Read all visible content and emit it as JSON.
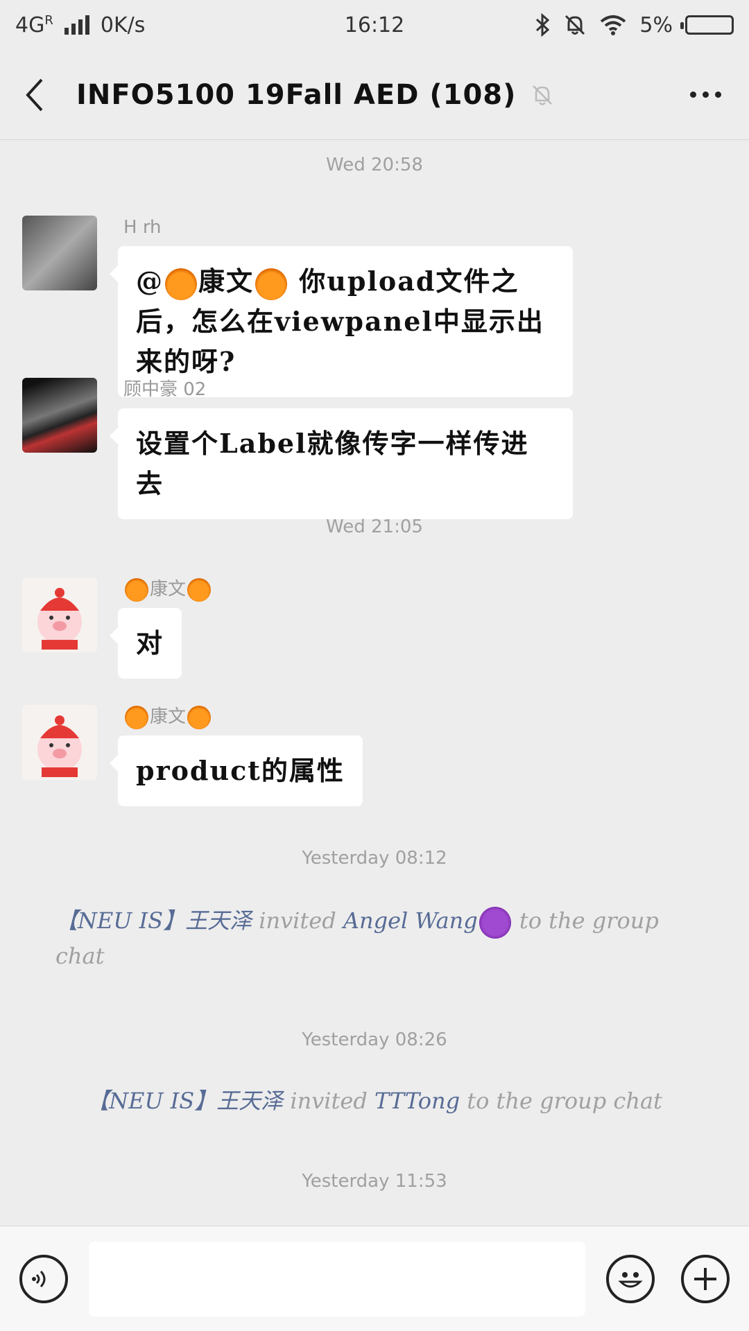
{
  "status_bar": {
    "network": "4G",
    "network_sup": "R",
    "speed": "0K/s",
    "time": "16:12",
    "battery": "5%"
  },
  "header": {
    "title": "INFO5100 19Fall AED (108)"
  },
  "messages": [
    {
      "type": "timestamp",
      "text": "Wed 20:58"
    },
    {
      "type": "message",
      "sender": "H rh",
      "text_prefix": "@",
      "mention_name": "康文",
      "text": " 你upload文件之后，怎么在viewpanel中显示出来的呀?"
    },
    {
      "type": "message",
      "sender": "顾中豪 02",
      "text": "设置个Label就像传字一样传进去"
    },
    {
      "type": "timestamp",
      "text": "Wed 21:05"
    },
    {
      "type": "message",
      "sender": "康文",
      "text": "对"
    },
    {
      "type": "message",
      "sender": "康文",
      "text": "product的属性"
    },
    {
      "type": "timestamp",
      "text": "Yesterday 08:12"
    },
    {
      "type": "system",
      "actor": "【NEU IS】王天泽",
      "verb": " invited ",
      "target": "Angel Wang",
      "suffix": " to the group chat"
    },
    {
      "type": "timestamp",
      "text": "Yesterday 08:26"
    },
    {
      "type": "system",
      "actor": "【NEU IS】王天泽",
      "verb": " invited ",
      "target": "TTTong",
      "suffix": " to the group chat"
    },
    {
      "type": "timestamp",
      "text": "Yesterday 11:53"
    }
  ],
  "input": {
    "placeholder": ""
  },
  "icons": {
    "back": "back-arrow-icon",
    "mute": "bell-off-icon",
    "more": "more-icon",
    "voice": "voice-icon",
    "emoji": "emoji-icon",
    "plus": "plus-icon"
  }
}
